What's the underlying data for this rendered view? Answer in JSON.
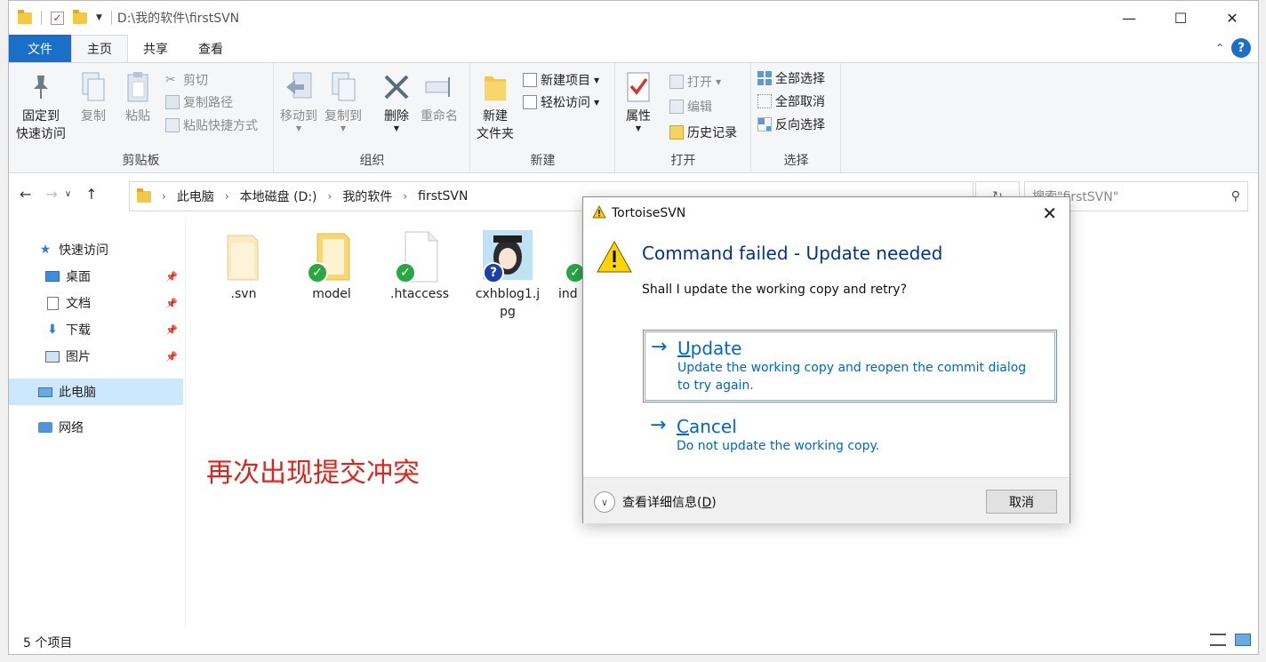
{
  "window": {
    "path_title": "D:\\我的软件\\firstSVN",
    "min": "—",
    "max": "☐",
    "close": "✕"
  },
  "ribbon_tabs": {
    "file": "文件",
    "home": "主页",
    "share": "共享",
    "view": "查看"
  },
  "ribbon": {
    "clipboard": {
      "label": "剪贴板",
      "pin": "固定到\n快速访问",
      "pin_line1": "固定到",
      "pin_line2": "快速访问",
      "copy": "复制",
      "paste": "粘贴",
      "cut": "剪切",
      "copy_path": "复制路径",
      "paste_shortcut": "粘贴快捷方式"
    },
    "organize": {
      "label": "组织",
      "move_to": "移动到",
      "copy_to": "复制到",
      "delete": "删除",
      "rename": "重命名"
    },
    "new": {
      "label": "新建",
      "new_folder_line1": "新建",
      "new_folder_line2": "文件夹",
      "new_item": "新建项目",
      "easy_access": "轻松访问"
    },
    "open": {
      "label": "打开",
      "properties": "属性",
      "open": "打开",
      "edit": "编辑",
      "history": "历史记录"
    },
    "select": {
      "label": "选择",
      "select_all": "全部选择",
      "select_none": "全部取消",
      "invert": "反向选择"
    }
  },
  "address": {
    "crumbs": [
      "此电脑",
      "本地磁盘 (D:)",
      "我的软件",
      "firstSVN"
    ],
    "search_placeholder": "搜索\"firstSVN\""
  },
  "nav": {
    "quick_access": "快速访问",
    "desktop": "桌面",
    "documents": "文档",
    "downloads": "下载",
    "pictures": "图片",
    "this_pc": "此电脑",
    "network": "网络"
  },
  "files": [
    {
      "name": ".svn"
    },
    {
      "name": "model"
    },
    {
      "name": ".htaccess"
    },
    {
      "name_line1": "cxhblog1.j",
      "name_line2": "pg"
    },
    {
      "name": "ind"
    }
  ],
  "annotation": "再次出现提交冲突",
  "status": {
    "count": "5 个项目"
  },
  "dialog": {
    "title": "TortoiseSVN",
    "heading": "Command failed - Update needed",
    "content": "Shall I update the working copy and retry?",
    "update": {
      "title_first": "U",
      "title_rest": "pdate",
      "desc_line1": "Update the working copy and reopen the commit dialog",
      "desc_line2": "to try again."
    },
    "cancel": {
      "title_first": "C",
      "title_rest": "ancel",
      "desc": "Do not update the working copy."
    },
    "details": "查看详细信息(D)",
    "details_prefix": "查看详细信息(",
    "details_key": "D",
    "details_suffix": ")",
    "cancel_button": "取消"
  },
  "colors": {
    "accent": "#1a6fc9",
    "link": "#0066cc",
    "heading": "#003399",
    "annotation": "#e2231a",
    "svn_ok": "#2aa745",
    "selection": "#cce8ff"
  }
}
